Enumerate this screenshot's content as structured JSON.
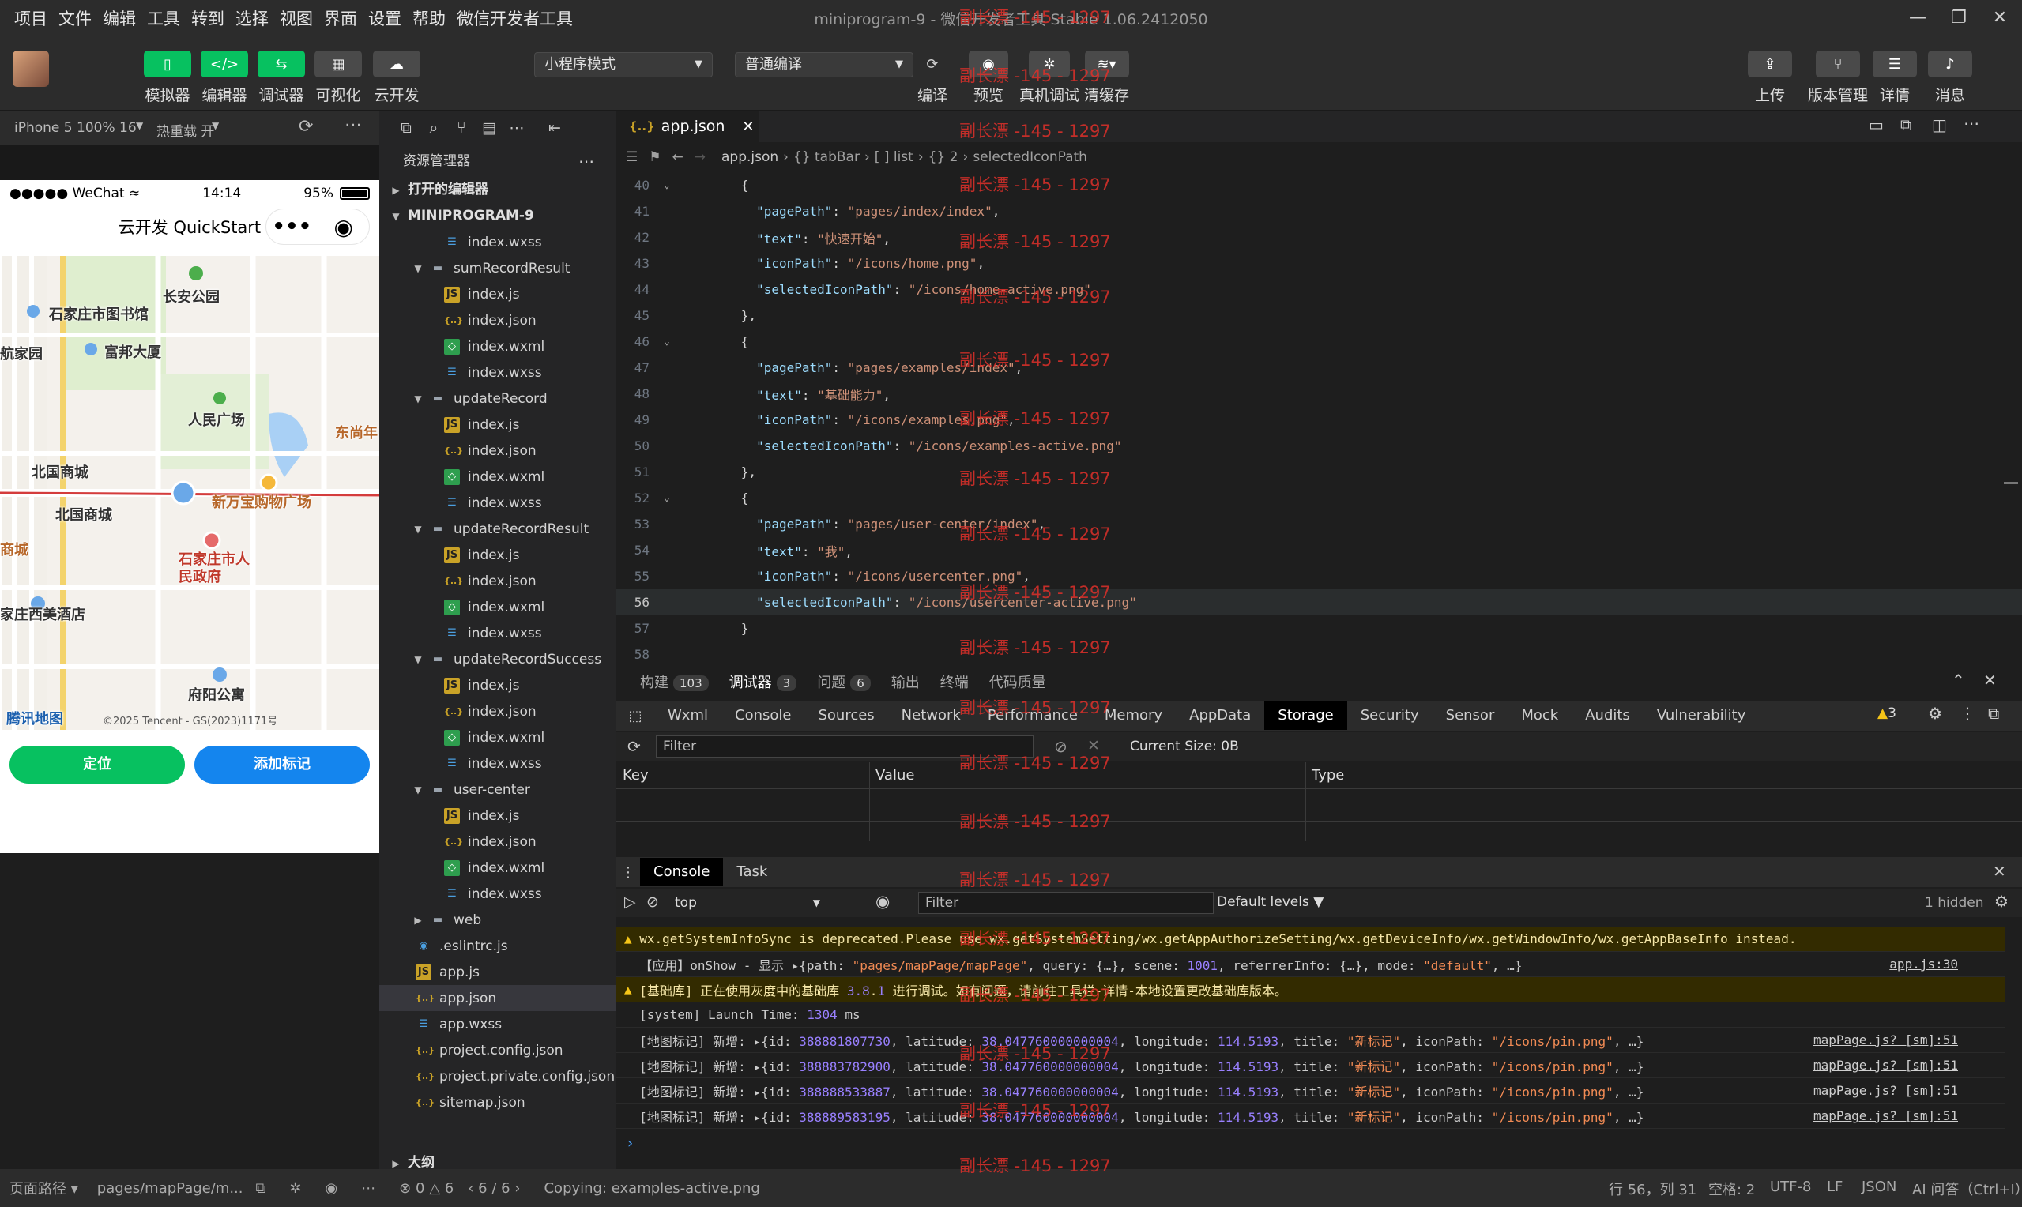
{
  "menu": [
    "项目",
    "文件",
    "编辑",
    "工具",
    "转到",
    "选择",
    "视图",
    "界面",
    "设置",
    "帮助",
    "微信开发者工具"
  ],
  "window_title": "miniprogram-9 - 微信开发者工具 Stable 1.06.2412050",
  "toolbar": {
    "left_buttons": [
      "模拟器",
      "编辑器",
      "调试器",
      "可视化",
      "云开发"
    ],
    "mode_select": "小程序模式",
    "compile_select": "普通编译",
    "center_buttons": [
      "编译",
      "预览",
      "真机调试",
      "清缓存"
    ],
    "right_buttons": [
      "上传",
      "版本管理",
      "详情",
      "消息"
    ]
  },
  "simulator": {
    "device": "iPhone 5 100% 16",
    "hot_reload": "热重载 开",
    "status_carrier": "WeChat",
    "status_time": "14:14",
    "status_battery": "95%",
    "nav_title": "云开发 QuickStart",
    "map_labels": [
      "长安公园",
      "石家庄市图书馆",
      "航家园",
      "富邦大厦",
      "人民广场",
      "东尚年",
      "北国商城",
      "北国商城",
      "新万宝购物广场",
      "商城",
      "石家庄市人民政府",
      "家庄西美酒店",
      "府阳公寓",
      "腾讯地图"
    ],
    "map_copyright": "©2025 Tencent - GS(2023)1171号",
    "btn_locate": "定位",
    "btn_add": "添加标记"
  },
  "explorer": {
    "title": "资源管理器",
    "open_editors": "打开的编辑器",
    "project": "MINIPROGRAM-9",
    "outline": "大纲",
    "items": [
      {
        "name": "index.wxss",
        "type": "wxss",
        "indent": 2
      },
      {
        "name": "sumRecordResult",
        "type": "dir",
        "indent": 1
      },
      {
        "name": "index.js",
        "type": "js",
        "indent": 2
      },
      {
        "name": "index.json",
        "type": "json",
        "indent": 2
      },
      {
        "name": "index.wxml",
        "type": "wxml",
        "indent": 2
      },
      {
        "name": "index.wxss",
        "type": "wxss",
        "indent": 2
      },
      {
        "name": "updateRecord",
        "type": "dir",
        "indent": 1
      },
      {
        "name": "index.js",
        "type": "js",
        "indent": 2
      },
      {
        "name": "index.json",
        "type": "json",
        "indent": 2
      },
      {
        "name": "index.wxml",
        "type": "wxml",
        "indent": 2
      },
      {
        "name": "index.wxss",
        "type": "wxss",
        "indent": 2
      },
      {
        "name": "updateRecordResult",
        "type": "dir",
        "indent": 1
      },
      {
        "name": "index.js",
        "type": "js",
        "indent": 2
      },
      {
        "name": "index.json",
        "type": "json",
        "indent": 2
      },
      {
        "name": "index.wxml",
        "type": "wxml",
        "indent": 2
      },
      {
        "name": "index.wxss",
        "type": "wxss",
        "indent": 2
      },
      {
        "name": "updateRecordSuccess",
        "type": "dir",
        "indent": 1
      },
      {
        "name": "index.js",
        "type": "js",
        "indent": 2
      },
      {
        "name": "index.json",
        "type": "json",
        "indent": 2
      },
      {
        "name": "index.wxml",
        "type": "wxml",
        "indent": 2
      },
      {
        "name": "index.wxss",
        "type": "wxss",
        "indent": 2
      },
      {
        "name": "user-center",
        "type": "dir",
        "indent": 1
      },
      {
        "name": "index.js",
        "type": "js",
        "indent": 2
      },
      {
        "name": "index.json",
        "type": "json",
        "indent": 2
      },
      {
        "name": "index.wxml",
        "type": "wxml",
        "indent": 2
      },
      {
        "name": "index.wxss",
        "type": "wxss",
        "indent": 2
      },
      {
        "name": "web",
        "type": "dirc",
        "indent": 1
      },
      {
        "name": ".eslintrc.js",
        "type": "eslint",
        "indent": 0
      },
      {
        "name": "app.js",
        "type": "js",
        "indent": 0
      },
      {
        "name": "app.json",
        "type": "json",
        "indent": 0,
        "active": true
      },
      {
        "name": "app.wxss",
        "type": "wxss",
        "indent": 0
      },
      {
        "name": "project.config.json",
        "type": "json",
        "indent": 0
      },
      {
        "name": "project.private.config.json",
        "type": "json",
        "indent": 0
      },
      {
        "name": "sitemap.json",
        "type": "json",
        "indent": 0
      }
    ]
  },
  "editor": {
    "tab": "app.json",
    "breadcrumbs": [
      "app.json",
      "{} tabBar",
      "[ ] list",
      "{} 2",
      "selectedIconPath"
    ],
    "lines": [
      {
        "n": "40",
        "code": "      {"
      },
      {
        "n": "41",
        "code": "        \"pagePath\": \"pages/index/index\","
      },
      {
        "n": "42",
        "code": "        \"text\": \"快速开始\","
      },
      {
        "n": "43",
        "code": "        \"iconPath\": \"/icons/home.png\","
      },
      {
        "n": "44",
        "code": "        \"selectedIconPath\": \"/icons/home-active.png\""
      },
      {
        "n": "45",
        "code": "      },"
      },
      {
        "n": "46",
        "code": "      {"
      },
      {
        "n": "47",
        "code": "        \"pagePath\": \"pages/examples/index\","
      },
      {
        "n": "48",
        "code": "        \"text\": \"基础能力\","
      },
      {
        "n": "49",
        "code": "        \"iconPath\": \"/icons/examples.png\","
      },
      {
        "n": "50",
        "code": "        \"selectedIconPath\": \"/icons/examples-active.png\""
      },
      {
        "n": "51",
        "code": "      },"
      },
      {
        "n": "52",
        "code": "      {"
      },
      {
        "n": "53",
        "code": "        \"pagePath\": \"pages/user-center/index\","
      },
      {
        "n": "54",
        "code": "        \"text\": \"我\","
      },
      {
        "n": "55",
        "code": "        \"iconPath\": \"/icons/usercenter.png\","
      },
      {
        "n": "56",
        "code": "        \"selectedIconPath\": \"/icons/usercenter-active.png\""
      },
      {
        "n": "57",
        "code": "      }"
      },
      {
        "n": "58",
        "code": ""
      }
    ]
  },
  "panel": {
    "tabs": [
      {
        "label": "构建",
        "badge": "103"
      },
      {
        "label": "调试器",
        "badge": "3"
      },
      {
        "label": "问题",
        "badge": "6"
      },
      {
        "label": "输出",
        "badge": ""
      },
      {
        "label": "终端",
        "badge": ""
      },
      {
        "label": "代码质量",
        "badge": ""
      }
    ],
    "devtools_tabs": [
      "Wxml",
      "Console",
      "Sources",
      "Network",
      "Performance",
      "Memory",
      "AppData",
      "Storage",
      "Security",
      "Sensor",
      "Mock",
      "Audits",
      "Vulnerability"
    ],
    "warn_count": "3",
    "storage_filter_placeholder": "Filter",
    "current_size": "Current Size: 0B",
    "storage_columns": [
      "Key",
      "Value",
      "Type"
    ],
    "drawer_tabs": [
      "Console",
      "Task"
    ],
    "context": "top",
    "console_filter_placeholder": "Filter",
    "levels": "Default levels",
    "hidden": "1 hidden",
    "console_lines": [
      {
        "kind": "warn",
        "text": "wx.getSystemInfoSync is deprecated.Please use wx.getSystemSetting/wx.getAppAuthorizeSetting/wx.getDeviceInfo/wx.getWindowInfo/wx.getAppBaseInfo instead.",
        "src": ""
      },
      {
        "kind": "log",
        "text": "【应用】onShow - 显示 ▸{path: \"pages/mapPage/mapPage\", query: {…}, scene: 1001, referrerInfo: {…}, mode: \"default\", …}",
        "src": "app.js:30"
      },
      {
        "kind": "warn",
        "text": "[基础库] 正在使用灰度中的基础库 3.8.1 进行调试。如有问题，请前往工具栏-详情-本地设置更改基础库版本。",
        "src": ""
      },
      {
        "kind": "log",
        "text": "[system] Launch Time: 1304 ms",
        "src": ""
      },
      {
        "kind": "log",
        "text": "[地图标记] 新增: ▸{id: 388881807730, latitude: 38.047760000000004, longitude: 114.5193, title: \"新标记\", iconPath: \"/icons/pin.png\", …}",
        "src": "mapPage.js? [sm]:51"
      },
      {
        "kind": "log",
        "text": "[地图标记] 新增: ▸{id: 388883782900, latitude: 38.047760000000004, longitude: 114.5193, title: \"新标记\", iconPath: \"/icons/pin.png\", …}",
        "src": "mapPage.js? [sm]:51"
      },
      {
        "kind": "log",
        "text": "[地图标记] 新增: ▸{id: 388888533887, latitude: 38.047760000000004, longitude: 114.5193, title: \"新标记\", iconPath: \"/icons/pin.png\", …}",
        "src": "mapPage.js? [sm]:51"
      },
      {
        "kind": "log",
        "text": "[地图标记] 新增: ▸{id: 388889583195, latitude: 38.047760000000004, longitude: 114.5193, title: \"新标记\", iconPath: \"/icons/pin.png\", …}",
        "src": "mapPage.js? [sm]:51"
      }
    ]
  },
  "statusbar": {
    "page_path_label": "页面路径",
    "page_path": "pages/mapPage/m...",
    "errors": "0",
    "warnings": "6",
    "pager": "6 / 6",
    "message": "Copying: examples-active.png",
    "position": "行 56，列 31",
    "spaces": "空格: 2",
    "encoding": "UTF-8",
    "eol": "LF",
    "lang": "JSON",
    "ai": "AI 问答（Ctrl+I）"
  },
  "watermark": "副长漂 -145 - 1297",
  "colors": {
    "accent_green": "#07c160",
    "accent_blue": "#1485ee",
    "warn_yellow": "#f5c518"
  }
}
